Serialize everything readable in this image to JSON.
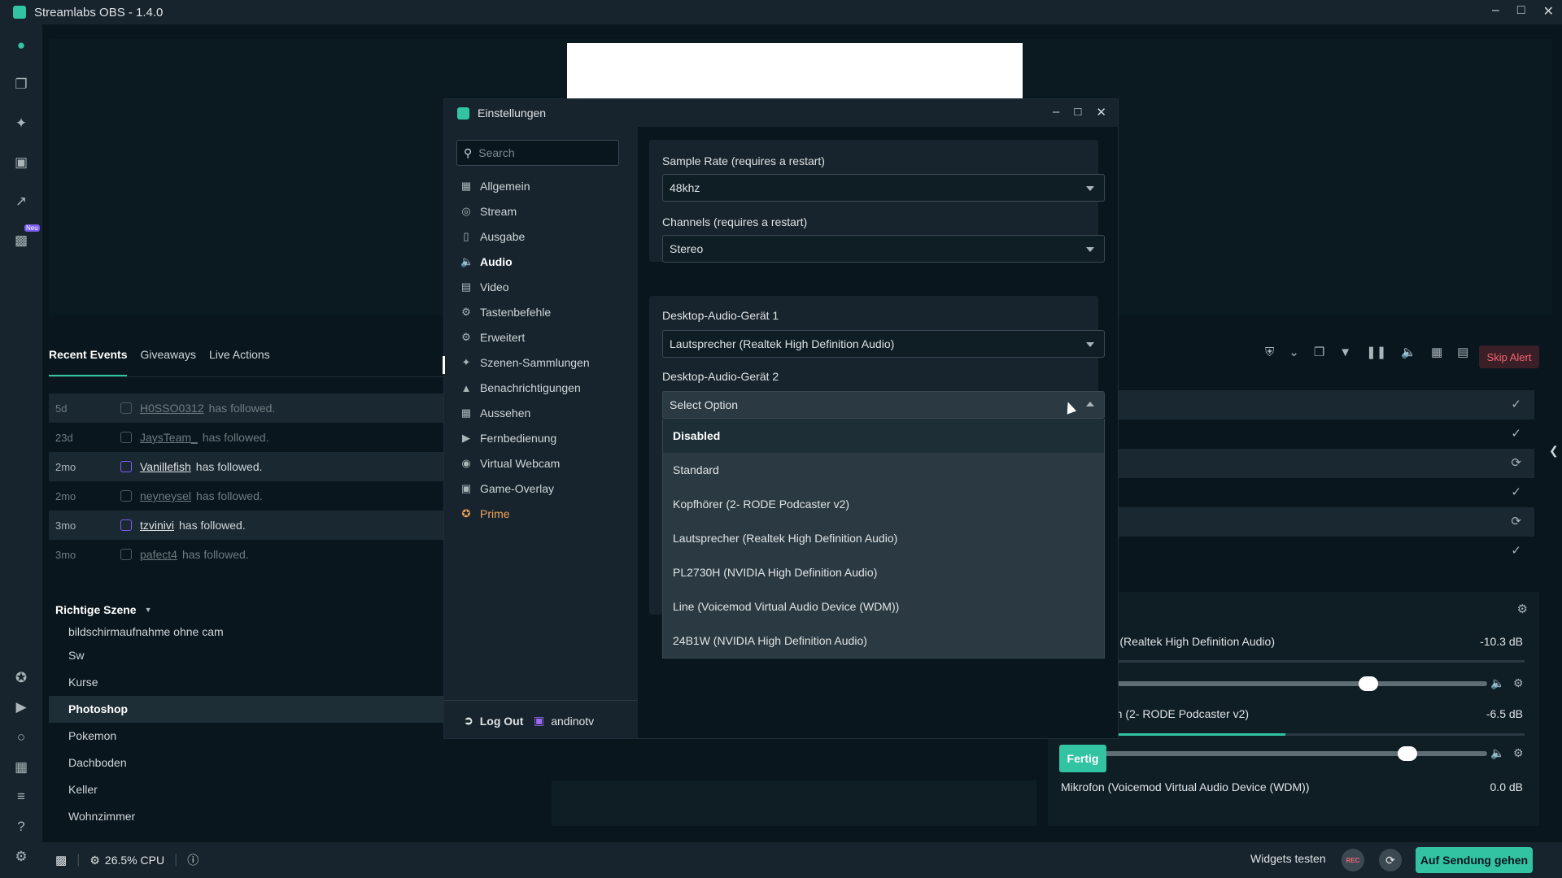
{
  "app": {
    "title": "Streamlabs OBS - 1.4.0"
  },
  "leftbar": {
    "neu_badge": "Neu"
  },
  "events": {
    "tabs": [
      "Recent Events",
      "Giveaways",
      "Live Actions"
    ],
    "rows": [
      {
        "time": "5d",
        "user": "H0SSO0312",
        "msg": "has followed."
      },
      {
        "time": "23d",
        "user": "JaysTeam_",
        "msg": "has followed."
      },
      {
        "time": "2mo",
        "user": "Vanillefish",
        "msg": "has followed."
      },
      {
        "time": "2mo",
        "user": "neyneysel",
        "msg": "has followed."
      },
      {
        "time": "3mo",
        "user": "tzvinivi",
        "msg": "has followed."
      },
      {
        "time": "3mo",
        "user": "pafect4",
        "msg": "has followed."
      }
    ],
    "skip_alert": "Skip Alert"
  },
  "scenes": {
    "header": "Richtige Szene",
    "items": [
      "bildschirmaufnahme ohne cam",
      "Sw",
      "Kurse",
      "Photoshop",
      "Pokemon",
      "Dachboden",
      "Keller",
      "Wohnzimmer"
    ]
  },
  "mixer": {
    "channels": [
      {
        "name": "er (Realtek High Definition Audio)",
        "db": "-10.3 dB"
      },
      {
        "name": "fon (2- RODE Podcaster v2)",
        "db": "-6.5 dB"
      },
      {
        "name": "Mikrofon (Voicemod Virtual Audio Device (WDM))",
        "db": "0.0 dB"
      }
    ]
  },
  "bottombar": {
    "cpu": "26.5% CPU",
    "widgets_test": "Widgets testen",
    "rec": "REC",
    "go_live": "Auf Sendung gehen"
  },
  "dialog": {
    "title": "Einstellungen",
    "search_placeholder": "Search",
    "nav": [
      {
        "label": "Allgemein",
        "icon": "grid-icon"
      },
      {
        "label": "Stream",
        "icon": "globe-icon"
      },
      {
        "label": "Ausgabe",
        "icon": "output-icon"
      },
      {
        "label": "Audio",
        "icon": "speaker-icon"
      },
      {
        "label": "Video",
        "icon": "film-icon"
      },
      {
        "label": "Tastenbefehle",
        "icon": "gear-icon"
      },
      {
        "label": "Erweitert",
        "icon": "gears-icon"
      },
      {
        "label": "Szenen-Sammlungen",
        "icon": "palette-icon"
      },
      {
        "label": "Benachrichtigungen",
        "icon": "bell-icon"
      },
      {
        "label": "Aussehen",
        "icon": "layout-icon"
      },
      {
        "label": "Fernbedienung",
        "icon": "play-circle-icon"
      },
      {
        "label": "Virtual Webcam",
        "icon": "camera-icon"
      },
      {
        "label": "Game-Overlay",
        "icon": "overlay-icon"
      },
      {
        "label": "Prime",
        "icon": "prime-icon"
      }
    ],
    "logout": "Log Out",
    "username": "andinotv",
    "sample_rate_label": "Sample Rate (requires a restart)",
    "sample_rate_value": "48khz",
    "channels_label": "Channels (requires a restart)",
    "channels_value": "Stereo",
    "desktop1_label": "Desktop-Audio-Gerät 1",
    "desktop1_value": "Lautsprecher (Realtek High Definition Audio)",
    "desktop2_label": "Desktop-Audio-Gerät 2",
    "desktop2_value": "Select Option",
    "desktop2_options": [
      "Disabled",
      "Standard",
      "Kopfhörer (2- RODE Podcaster v2)",
      "Lautsprecher (Realtek High Definition Audio)",
      "PL2730H (NVIDIA High Definition Audio)",
      "Line (Voicemod Virtual Audio Device (WDM))",
      "24B1W (NVIDIA High Definition Audio)"
    ],
    "done": "Fertig"
  },
  "colors": {
    "accent": "#31c3a2",
    "prime": "#f0a55a",
    "danger": "#f56473"
  }
}
